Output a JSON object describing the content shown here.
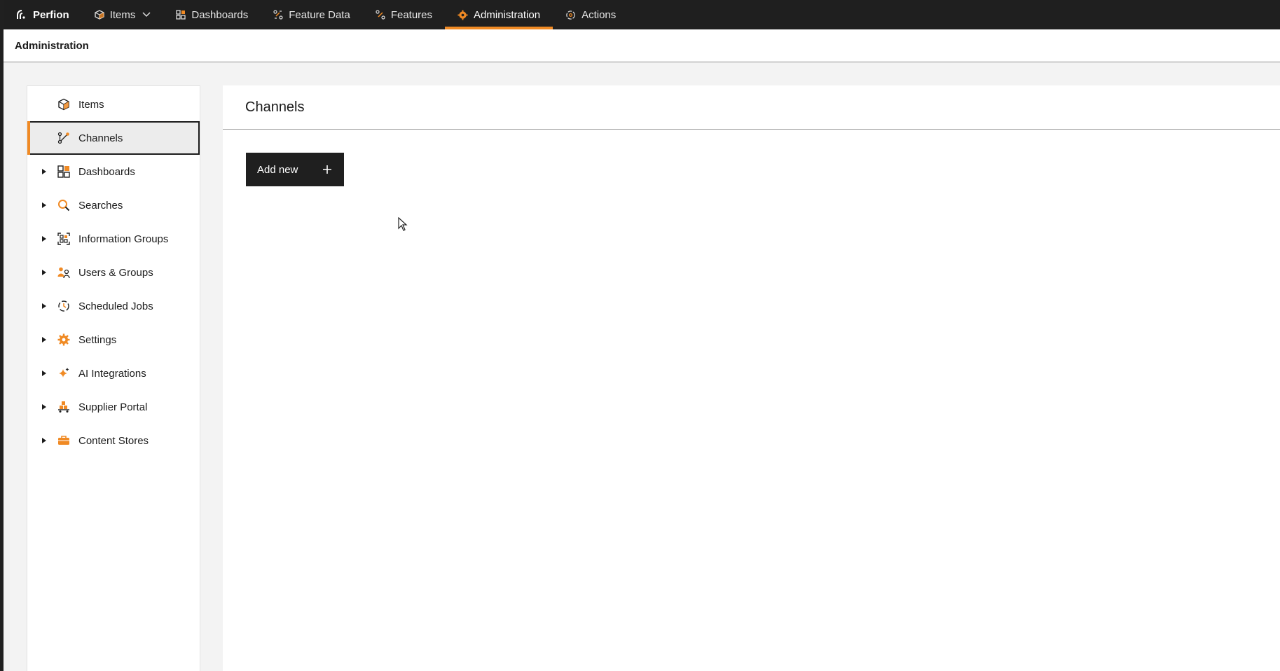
{
  "colors": {
    "accent": "#f08a24",
    "topbar_bg": "#1f1f1f",
    "selected_bg": "#ececec"
  },
  "topbar": {
    "brand": "Perfion",
    "nav": [
      {
        "label": "Items",
        "icon": "cube-icon",
        "dropdown": true
      },
      {
        "label": "Dashboards",
        "icon": "grid-icon"
      },
      {
        "label": "Feature Data",
        "icon": "feature-data-icon"
      },
      {
        "label": "Features",
        "icon": "features-icon"
      },
      {
        "label": "Administration",
        "icon": "gear-icon",
        "active": true
      },
      {
        "label": "Actions",
        "icon": "actions-icon"
      }
    ]
  },
  "breadcrumb": {
    "title": "Administration"
  },
  "sidebar": {
    "items": [
      {
        "label": "Items",
        "icon": "cube-icon",
        "expandable": false
      },
      {
        "label": "Channels",
        "icon": "channels-icon",
        "expandable": false,
        "selected": true
      },
      {
        "label": "Dashboards",
        "icon": "grid-icon",
        "expandable": true
      },
      {
        "label": "Searches",
        "icon": "search-icon",
        "expandable": true
      },
      {
        "label": "Information Groups",
        "icon": "information-groups-icon",
        "expandable": true
      },
      {
        "label": "Users & Groups",
        "icon": "users-icon",
        "expandable": true
      },
      {
        "label": "Scheduled Jobs",
        "icon": "scheduled-jobs-icon",
        "expandable": true
      },
      {
        "label": "Settings",
        "icon": "gear-icon",
        "expandable": true
      },
      {
        "label": "AI Integrations",
        "icon": "sparkle-icon",
        "expandable": true
      },
      {
        "label": "Supplier Portal",
        "icon": "supplier-portal-icon",
        "expandable": true
      },
      {
        "label": "Content Stores",
        "icon": "briefcase-icon",
        "expandable": true
      }
    ]
  },
  "main": {
    "title": "Channels",
    "add_button": "Add new",
    "add_button_icon": "plus-icon"
  }
}
